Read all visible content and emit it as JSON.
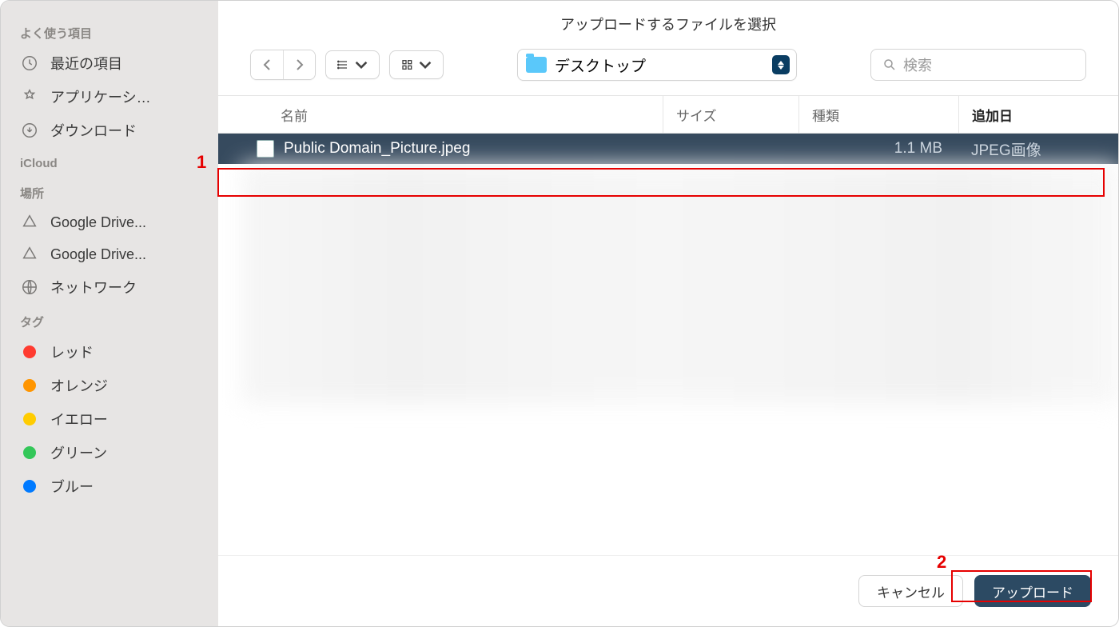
{
  "title": "アップロードするファイルを選択",
  "sidebar": {
    "favorites_header": "よく使う項目",
    "favorites": [
      {
        "label": "最近の項目",
        "icon": "clock"
      },
      {
        "label": "アプリケーシ…",
        "icon": "apps"
      },
      {
        "label": "ダウンロード",
        "icon": "download"
      }
    ],
    "icloud_header": "iCloud",
    "locations_header": "場所",
    "locations": [
      {
        "label": "Google Drive...",
        "icon": "gdrive"
      },
      {
        "label": "Google Drive...",
        "icon": "gdrive"
      },
      {
        "label": "ネットワーク",
        "icon": "network"
      }
    ],
    "tags_header": "タグ",
    "tags": [
      {
        "label": "レッド",
        "color": "#ff3b30"
      },
      {
        "label": "オレンジ",
        "color": "#ff9500"
      },
      {
        "label": "イエロー",
        "color": "#ffcc00"
      },
      {
        "label": "グリーン",
        "color": "#34c759"
      },
      {
        "label": "ブルー",
        "color": "#007aff"
      }
    ]
  },
  "toolbar": {
    "location": "デスクトップ",
    "search_placeholder": "検索"
  },
  "columns": {
    "name": "名前",
    "size": "サイズ",
    "kind": "種類",
    "date": "追加日"
  },
  "files": [
    {
      "name": "Public Domain_Picture.jpeg",
      "size": "1.1 MB",
      "kind": "JPEG画像",
      "selected": true
    }
  ],
  "footer": {
    "cancel": "キャンセル",
    "upload": "アップロード"
  },
  "annotations": {
    "num1": "1",
    "num2": "2"
  }
}
